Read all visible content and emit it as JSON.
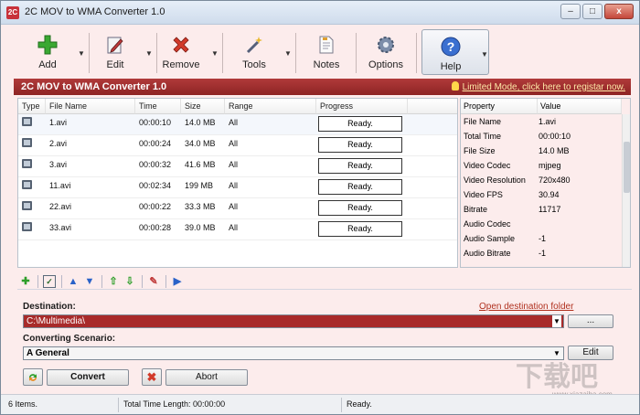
{
  "window": {
    "title": "2C MOV to WMA Converter 1.0",
    "buttons": {
      "minimize": "–",
      "maximize": "□",
      "close": "x"
    }
  },
  "toolbar": {
    "add": "Add",
    "edit": "Edit",
    "remove": "Remove",
    "tools": "Tools",
    "notes": "Notes",
    "options": "Options",
    "help": "Help"
  },
  "banner": {
    "title": "2C MOV to WMA Converter 1.0",
    "link": "Limited Mode, click here to registar now."
  },
  "filelist": {
    "columns": [
      "Type",
      "File Name",
      "Time",
      "Size",
      "Range",
      "Progress"
    ],
    "rows": [
      {
        "name": "1.avi",
        "time": "00:00:10",
        "size": "14.0 MB",
        "range": "All",
        "progress": "Ready."
      },
      {
        "name": "2.avi",
        "time": "00:00:24",
        "size": "34.0 MB",
        "range": "All",
        "progress": "Ready."
      },
      {
        "name": "3.avi",
        "time": "00:00:32",
        "size": "41.6 MB",
        "range": "All",
        "progress": "Ready."
      },
      {
        "name": "11.avi",
        "time": "00:02:34",
        "size": "199 MB",
        "range": "All",
        "progress": "Ready."
      },
      {
        "name": "22.avi",
        "time": "00:00:22",
        "size": "33.3 MB",
        "range": "All",
        "progress": "Ready."
      },
      {
        "name": "33.avi",
        "time": "00:00:28",
        "size": "39.0 MB",
        "range": "All",
        "progress": "Ready."
      }
    ]
  },
  "properties": {
    "columns": [
      "Property",
      "Value"
    ],
    "rows": [
      {
        "k": "File Name",
        "v": "1.avi"
      },
      {
        "k": "Total Time",
        "v": "00:00:10"
      },
      {
        "k": "File Size",
        "v": "14.0 MB"
      },
      {
        "k": "Video Codec",
        "v": "mjpeg"
      },
      {
        "k": "Video Resolution",
        "v": "720x480"
      },
      {
        "k": "Video FPS",
        "v": "30.94"
      },
      {
        "k": "Bitrate",
        "v": "11717"
      },
      {
        "k": "Audio Codec",
        "v": ""
      },
      {
        "k": "Audio Sample",
        "v": "-1"
      },
      {
        "k": "Audio Bitrate",
        "v": "-1"
      }
    ]
  },
  "destination": {
    "label": "Destination:",
    "open_folder": "Open destination folder",
    "path": "C:\\Multimedia\\",
    "browse": "..."
  },
  "scenario": {
    "label": "Converting Scenario:",
    "value": "A General",
    "edit": "Edit"
  },
  "actions": {
    "convert": "Convert",
    "abort": "Abort"
  },
  "status": {
    "items": "6 Items.",
    "total_time": "Total Time Length: 00:00:00",
    "state": "Ready."
  },
  "watermark": {
    "glyphs": "下载吧",
    "url": "www.xiazaiba.com"
  },
  "colors": {
    "accent_red": "#a82a2a",
    "panel_pink": "#fcecec"
  }
}
